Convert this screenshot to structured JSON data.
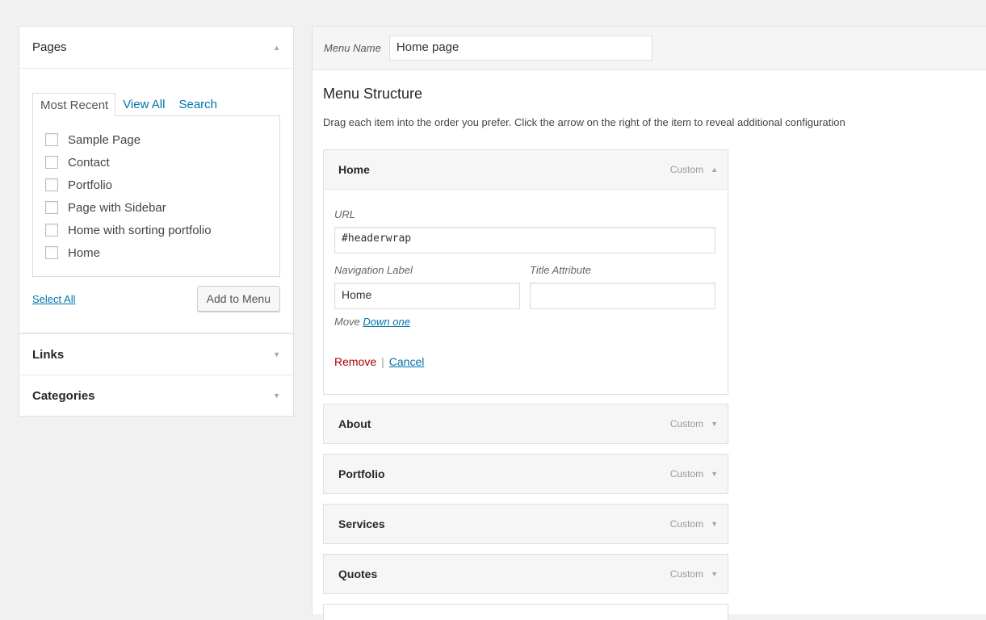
{
  "left_panel": {
    "pages": {
      "title": "Pages",
      "tabs": [
        "Most Recent",
        "View All",
        "Search"
      ],
      "items": [
        "Sample Page",
        "Contact",
        "Portfolio",
        "Page with Sidebar",
        "Home with sorting portfolio",
        "Home"
      ],
      "select_all": "Select All",
      "add_button": "Add to Menu"
    },
    "links_title": "Links",
    "categories_title": "Categories"
  },
  "menu": {
    "name_label": "Menu Name",
    "name_value": "Home page",
    "structure_title": "Menu Structure",
    "structure_description": "Drag each item into the order you prefer. Click the arrow on the right of the item to reveal additional configuration",
    "items": [
      {
        "title": "Home",
        "type": "Custom",
        "expanded": true
      },
      {
        "title": "About",
        "type": "Custom"
      },
      {
        "title": "Portfolio",
        "type": "Custom"
      },
      {
        "title": "Services",
        "type": "Custom"
      },
      {
        "title": "Quotes",
        "type": "Custom"
      }
    ],
    "settings": {
      "url_label": "URL",
      "url_value": "#headerwrap",
      "nav_label": "Navigation Label",
      "nav_value": "Home",
      "title_attr_label": "Title Attribute",
      "title_attr_value": "",
      "move_label": "Move",
      "move_link": "Down one",
      "remove": "Remove",
      "separator": "|",
      "cancel": "Cancel"
    }
  },
  "icons": {
    "collapse": "triangle-up-icon",
    "expand": "triangle-down-icon"
  }
}
